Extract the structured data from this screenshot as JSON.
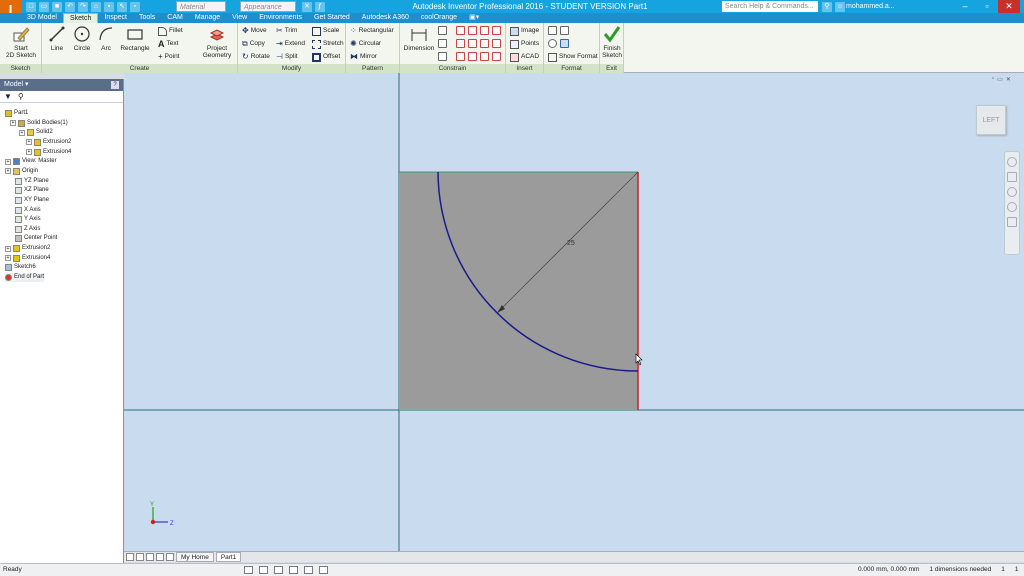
{
  "app": {
    "title": "Autodesk Inventor Professional 2016 - STUDENT VERSION    Part1",
    "logo_letter": "I",
    "logo_sub": "PRO",
    "material_placeholder": "Material",
    "appearance_placeholder": "Appearance",
    "search_placeholder": "Search Help & Commands...",
    "user": "mohammed.a...",
    "accent_color": "#16a4e0"
  },
  "tabs": [
    "3D Model",
    "Sketch",
    "Inspect",
    "Tools",
    "CAM",
    "Manage",
    "View",
    "Environments",
    "Get Started",
    "Autodesk A360",
    "coolOrange"
  ],
  "ribbon": {
    "sketch": {
      "start_line1": "Start",
      "start_line2": "2D Sketch",
      "title": "Sketch"
    },
    "create": {
      "line": "Line",
      "circle": "Circle",
      "arc": "Arc",
      "rectangle": "Rectangle",
      "fillet": "Fillet",
      "text": "Text",
      "point": "Point",
      "project_line1": "Project",
      "project_line2": "Geometry",
      "title": "Create"
    },
    "modify": {
      "move": "Move",
      "copy": "Copy",
      "rotate": "Rotate",
      "trim": "Trim",
      "extend": "Extend",
      "split": "Split",
      "scale": "Scale",
      "stretch": "Stretch",
      "offset": "Offset",
      "title": "Modify"
    },
    "pattern": {
      "rectangular": "Rectangular",
      "circular": "Circular",
      "mirror": "Mirror",
      "title": "Pattern"
    },
    "constrain": {
      "dimension": "Dimension",
      "title": "Constrain"
    },
    "insert": {
      "image": "Image",
      "points": "Points",
      "acad": "ACAD",
      "title": "Insert"
    },
    "format": {
      "show_format": "Show Format",
      "title": "Format"
    },
    "exit": {
      "finish_line1": "Finish",
      "finish_line2": "Sketch",
      "title": "Exit"
    }
  },
  "browser": {
    "title": "Model",
    "help": "?",
    "tree": [
      {
        "label": "Part1",
        "icon": "part-icon"
      },
      {
        "label": "Solid Bodies(1)",
        "icon": "solid-bodies-icon"
      },
      {
        "label": "Solid2",
        "icon": "solid-icon"
      },
      {
        "label": "Extrusion2",
        "icon": "extrusion-icon"
      },
      {
        "label": "Extrusion4",
        "icon": "extrusion-icon"
      },
      {
        "label": "View: Master",
        "icon": "view-icon"
      },
      {
        "label": "Origin",
        "icon": "folder-icon"
      },
      {
        "label": "YZ Plane",
        "icon": "plane-icon"
      },
      {
        "label": "XZ Plane",
        "icon": "plane-icon"
      },
      {
        "label": "XY Plane",
        "icon": "plane-icon"
      },
      {
        "label": "X Axis",
        "icon": "axis-icon"
      },
      {
        "label": "Y Axis",
        "icon": "axis-icon"
      },
      {
        "label": "Z Axis",
        "icon": "axis-icon"
      },
      {
        "label": "Center Point",
        "icon": "point-icon"
      },
      {
        "label": "Extrusion2",
        "icon": "extrusion-icon"
      },
      {
        "label": "Extrusion4",
        "icon": "extrusion-icon"
      },
      {
        "label": "Sketch6",
        "icon": "sketch-icon"
      },
      {
        "label": "End of Part",
        "icon": "end-of-part-icon"
      }
    ]
  },
  "canvas": {
    "viewcube_label": "LEFT",
    "dimension_value": "25",
    "triad_y": "Y",
    "triad_z": "Z",
    "background_color": "#c9dcef",
    "face_color": "#9b9b9b",
    "arc_color": "#1a1a8c",
    "edge_color": "#d0202a"
  },
  "doc_tabs": {
    "home": "My Home",
    "part": "Part1"
  },
  "status": {
    "left": "Ready",
    "coords": "0.000 mm, 0.000 mm",
    "dims_needed": "1 dimensions needed",
    "count1": "1",
    "count2": "1"
  }
}
